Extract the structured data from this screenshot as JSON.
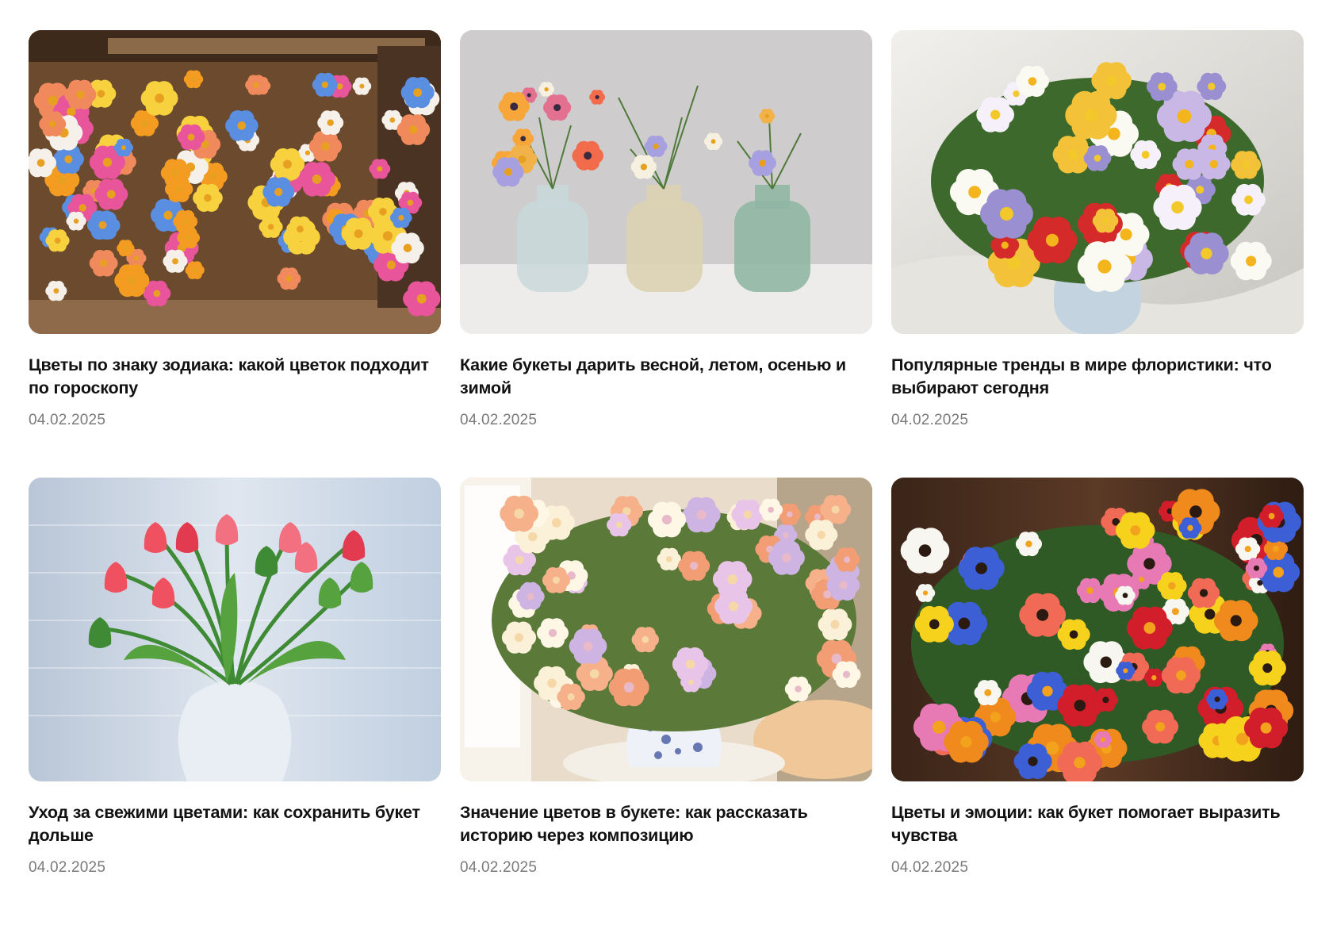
{
  "articles": [
    {
      "title": "Цветы по знаку зодиака: какой цветок подходит по гороскопу",
      "date": "04.02.2025",
      "image": "flower-market-stall",
      "palette": [
        "#f08a5d",
        "#e8559a",
        "#f7d23e",
        "#5a8ee0",
        "#f5f1ea",
        "#f39c21"
      ]
    },
    {
      "title": "Какие букеты дарить весной, летом, осенью и зимой",
      "date": "04.02.2025",
      "image": "three-glass-vases",
      "palette": [
        "#e3708f",
        "#a7a0e0",
        "#f7a73a",
        "#f6f0e0",
        "#f26b4a",
        "#f2b24a"
      ]
    },
    {
      "title": "Популярные тренды в мире флористики: что выбирают сегодня",
      "date": "04.02.2025",
      "image": "white-lily-bouquet",
      "palette": [
        "#fbfaf2",
        "#9a8fd0",
        "#d42a2a",
        "#f4c238",
        "#c9b8e6",
        "#f5f0fa"
      ]
    },
    {
      "title": "Уход за свежими цветами: как сохранить букет дольше",
      "date": "04.02.2025",
      "image": "red-tulips-vase",
      "palette": [
        "#ef5161",
        "#f27080",
        "#e23a4e",
        "#3f8a34",
        "#56a23f"
      ]
    },
    {
      "title": "Значение цветов в букете: как рассказать историю через композицию",
      "date": "04.02.2025",
      "image": "pastel-bouquet-blue-vase",
      "palette": [
        "#f6b08a",
        "#cdb4e3",
        "#fbf0d8",
        "#f29d74",
        "#e9c4e9",
        "#fff7e6"
      ]
    },
    {
      "title": "Цветы и эмоции: как букет помогает выразить чувства",
      "date": "04.02.2025",
      "image": "bright-mixed-bouquet",
      "palette": [
        "#f7d21c",
        "#f06a56",
        "#e77ab4",
        "#3c5fd6",
        "#f8f6f0",
        "#f08a1c",
        "#d21d2a"
      ]
    }
  ]
}
